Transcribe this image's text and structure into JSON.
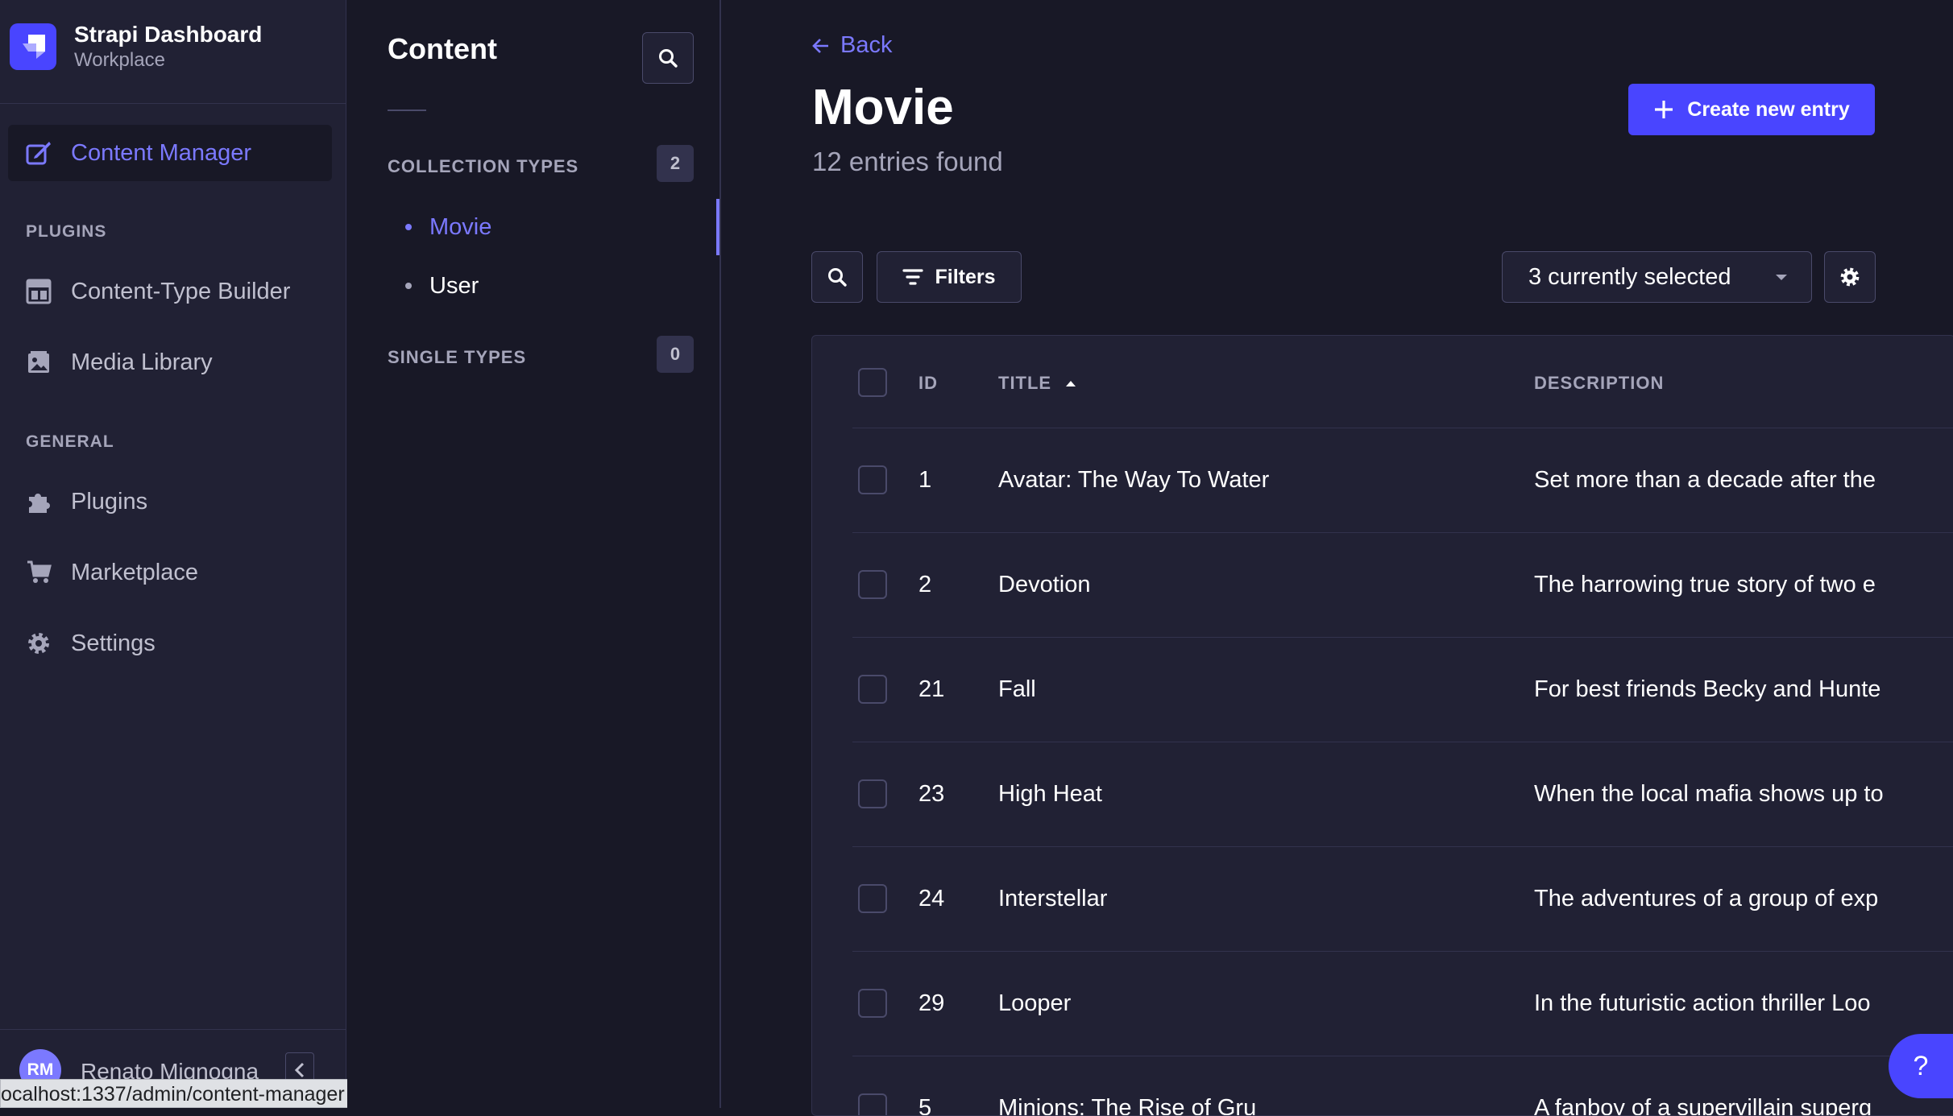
{
  "brand": {
    "title": "Strapi Dashboard",
    "subtitle": "Workplace"
  },
  "leftnav": {
    "content_manager": "Content Manager",
    "plugins_section": "PLUGINS",
    "content_type_builder": "Content-Type Builder",
    "media_library": "Media Library",
    "general_section": "GENERAL",
    "plugins": "Plugins",
    "marketplace": "Marketplace",
    "settings": "Settings"
  },
  "user": {
    "initials": "RM",
    "name": "Renato Mignogna"
  },
  "status_url": "ocalhost:1337/admin/content-manager",
  "subnav": {
    "title": "Content",
    "collection_types": "COLLECTION TYPES",
    "collection_count": "2",
    "collection_items": [
      {
        "label": "Movie"
      },
      {
        "label": "User"
      }
    ],
    "single_types": "SINGLE TYPES",
    "single_count": "0"
  },
  "header": {
    "back": "Back",
    "title": "Movie",
    "subtitle": "12 entries found",
    "create_button": "Create new entry"
  },
  "toolbar": {
    "filters": "Filters",
    "columns_selected": "3 currently selected"
  },
  "table": {
    "headers": {
      "id": "ID",
      "title": "TITLE",
      "description": "DESCRIPTION"
    },
    "rows": [
      {
        "id": "1",
        "title": "Avatar: The Way To Water",
        "description": "Set more than a decade after the"
      },
      {
        "id": "2",
        "title": "Devotion",
        "description": "The harrowing true story of two e"
      },
      {
        "id": "21",
        "title": "Fall",
        "description": "For best friends Becky and Hunte"
      },
      {
        "id": "23",
        "title": "High Heat",
        "description": "When the local mafia shows up to"
      },
      {
        "id": "24",
        "title": "Interstellar",
        "description": "The adventures of a group of exp"
      },
      {
        "id": "29",
        "title": "Looper",
        "description": "In the futuristic action thriller Loo"
      },
      {
        "id": "5",
        "title": "Minions: The Rise of Gru",
        "description": "A fanboy of a supervillain superg"
      }
    ]
  },
  "help": {
    "label": "?"
  },
  "colors": {
    "accent": "#4945ff",
    "accent_text": "#7b79ff",
    "background": "#181826",
    "surface": "#212134"
  }
}
